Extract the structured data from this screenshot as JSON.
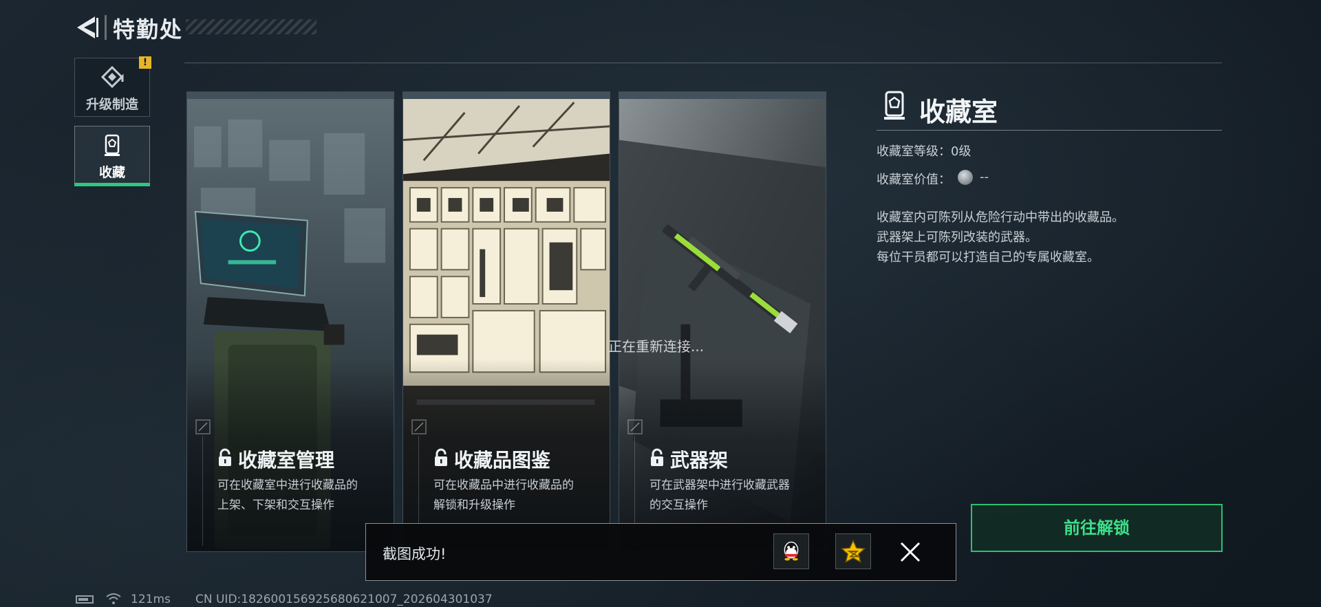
{
  "header": {
    "title": "特勤处",
    "back_icon": "back-arrow-icon"
  },
  "nav": {
    "items": [
      {
        "label": "升级制造",
        "icon": "upgrade-craft-icon",
        "badge": "!"
      },
      {
        "label": "收藏",
        "icon": "collection-room-icon",
        "selected": true
      }
    ],
    "accent": "#2ec97c"
  },
  "cards": [
    {
      "title": "收藏室管理",
      "desc_line1": "可在收藏室中进行收藏品的",
      "desc_line2": "上架、下架和交互操作",
      "icon": "lock-icon"
    },
    {
      "title": "收藏品图鉴",
      "desc_line1": "可在收藏品中进行收藏品的",
      "desc_line2": "解锁和升级操作",
      "icon": "lock-icon"
    },
    {
      "title": "武器架",
      "desc_line1": "可在武器架中进行收藏武器",
      "desc_line2": "的交互操作",
      "icon": "lock-icon"
    }
  ],
  "panel": {
    "title": "收藏室",
    "level": "收藏室等级：0级",
    "value_label": "收藏室价值：",
    "value": "--",
    "desc": [
      "收藏室内可陈列从危险行动中带出的收藏品。",
      "武器架上可陈列改装的武器。",
      "每位干员都可以打造自己的专属收藏室。"
    ],
    "unlock_button": "前往解锁"
  },
  "overlay": {
    "reconnect": "正在重新连接..."
  },
  "toast": {
    "text": "截图成功!",
    "qq_icon": "qq-icon",
    "qzone_icon": "qzone-star-icon",
    "close_icon": "close-icon"
  },
  "status": {
    "ping": "121ms",
    "uid": "CN UID:1826001569256806210​07_202604301037"
  }
}
